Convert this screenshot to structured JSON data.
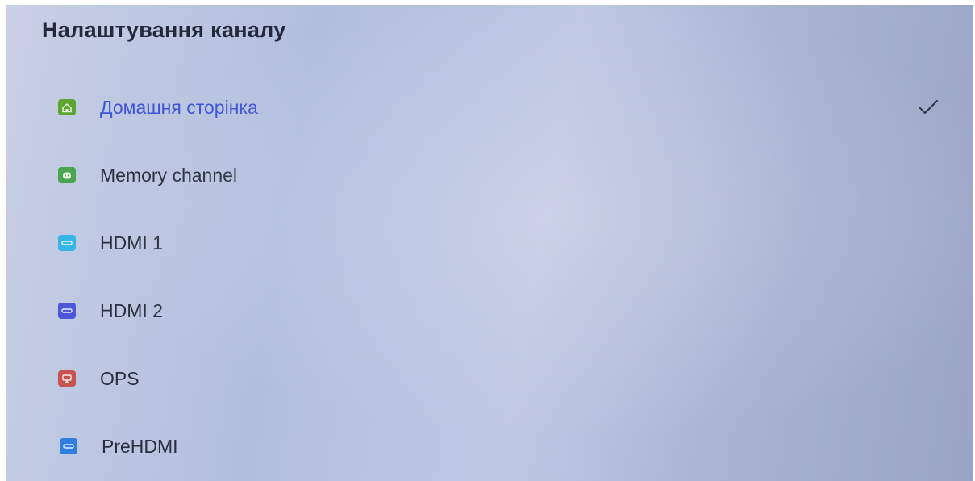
{
  "page": {
    "title": "Налаштування каналу"
  },
  "channels": [
    {
      "label": "Домашня сторінка",
      "icon": "home-icon",
      "color": "#5fa532",
      "selected": true
    },
    {
      "label": "Memory channel",
      "icon": "android-icon",
      "color": "#4aa64e",
      "selected": false
    },
    {
      "label": "HDMI 1",
      "icon": "hdmi-port-icon",
      "color": "#37b6e6",
      "selected": false
    },
    {
      "label": "HDMI 2",
      "icon": "hdmi-port-icon",
      "color": "#4e56d9",
      "selected": false
    },
    {
      "label": "OPS",
      "icon": "monitor-icon",
      "color": "#c85450",
      "selected": false
    },
    {
      "label": "PreHDMI",
      "icon": "hdmi-port-icon",
      "color": "#2f7fe0",
      "selected": false
    }
  ],
  "colors": {
    "accent": "#3f54d6",
    "text": "#2a2f3e",
    "title": "#23293a"
  }
}
